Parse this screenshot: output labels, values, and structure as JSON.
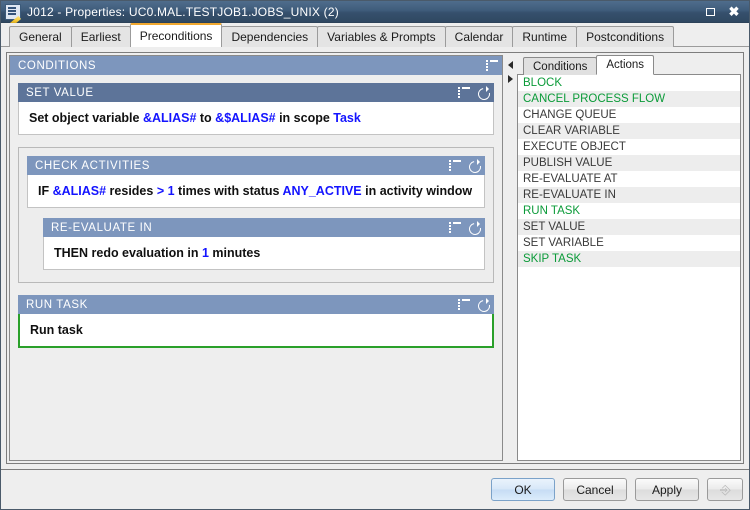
{
  "window": {
    "title": "J012 - Properties: UC0.MAL.TESTJOB1.JOBS_UNIX (2)",
    "icon": "properties-edit-icon",
    "maximize_label": "Maximize",
    "close_label": "Close"
  },
  "tabs": [
    {
      "label": "General",
      "active": false
    },
    {
      "label": "Earliest",
      "active": false
    },
    {
      "label": "Preconditions",
      "active": true
    },
    {
      "label": "Dependencies",
      "active": false
    },
    {
      "label": "Variables & Prompts",
      "active": false
    },
    {
      "label": "Calendar",
      "active": false
    },
    {
      "label": "Runtime",
      "active": false
    },
    {
      "label": "Postconditions",
      "active": false
    }
  ],
  "conditions_panel": {
    "title": "CONDITIONS",
    "blocks": {
      "set_value": {
        "title": "SET VALUE",
        "text_parts": [
          {
            "t": "Set object variable ",
            "blue": false
          },
          {
            "t": "&ALIAS#",
            "blue": true
          },
          {
            "t": " to ",
            "blue": false
          },
          {
            "t": "&$ALIAS#",
            "blue": true
          },
          {
            "t": " in scope ",
            "blue": false
          },
          {
            "t": "Task",
            "blue": true
          }
        ]
      },
      "check_activities": {
        "title": "CHECK ACTIVITIES",
        "text_parts": [
          {
            "t": "IF ",
            "blue": false
          },
          {
            "t": "&ALIAS#",
            "blue": true
          },
          {
            "t": " resides ",
            "blue": false
          },
          {
            "t": ">",
            "blue": true
          },
          {
            "t": " ",
            "blue": false
          },
          {
            "t": "1",
            "blue": true
          },
          {
            "t": " times with status ",
            "blue": false
          },
          {
            "t": "ANY_ACTIVE",
            "blue": true
          },
          {
            "t": " in activity window",
            "blue": false
          }
        ]
      },
      "re_evaluate_in": {
        "title": "RE-EVALUATE IN",
        "text_parts": [
          {
            "t": "THEN redo evaluation in ",
            "blue": false
          },
          {
            "t": "1",
            "blue": true
          },
          {
            "t": " minutes",
            "blue": false
          }
        ]
      },
      "run_task": {
        "title": "RUN TASK",
        "text_parts": [
          {
            "t": "Run task",
            "blue": false
          }
        ]
      }
    },
    "icons": {
      "list": "list-icon",
      "refresh": "refresh-icon"
    }
  },
  "splitter": {
    "collapse_left": "collapse-left-arrow",
    "collapse_right": "collapse-right-arrow"
  },
  "right_panel": {
    "tabs": [
      {
        "label": "Conditions",
        "active": false
      },
      {
        "label": "Actions",
        "active": true
      }
    ],
    "items": [
      {
        "label": "BLOCK",
        "highlight": true
      },
      {
        "label": "CANCEL PROCESS FLOW",
        "highlight": true
      },
      {
        "label": "CHANGE QUEUE",
        "highlight": false
      },
      {
        "label": "CLEAR VARIABLE",
        "highlight": false
      },
      {
        "label": "EXECUTE OBJECT",
        "highlight": false
      },
      {
        "label": "PUBLISH VALUE",
        "highlight": false
      },
      {
        "label": "RE-EVALUATE AT",
        "highlight": false
      },
      {
        "label": "RE-EVALUATE IN",
        "highlight": false
      },
      {
        "label": "RUN TASK",
        "highlight": true
      },
      {
        "label": "SET VALUE",
        "highlight": false
      },
      {
        "label": "SET VARIABLE",
        "highlight": false
      },
      {
        "label": "SKIP TASK",
        "highlight": true
      }
    ]
  },
  "footer": {
    "ok": "OK",
    "cancel": "Cancel",
    "apply": "Apply",
    "extra_icon": "script-disabled-icon"
  },
  "colors": {
    "titlebar": "#3f5c7b",
    "header_light": "#7d96bd",
    "header_dark": "#5d7499",
    "token_blue": "#1414ff",
    "highlight_green": "#0b9b39",
    "run_task_border": "#2aa02a",
    "active_tab_accent": "#f0a830"
  }
}
